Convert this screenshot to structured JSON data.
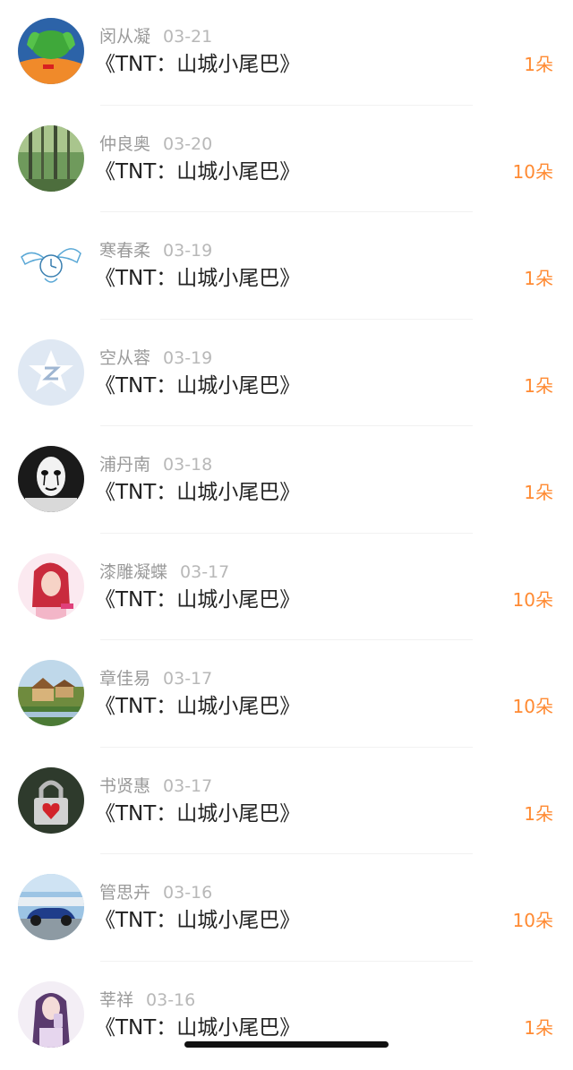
{
  "colors": {
    "accent": "#ff8a32",
    "title": "#222222",
    "name": "#9a9a9a",
    "date": "#b8b8b8"
  },
  "gifts": [
    {
      "name": "闵从凝",
      "date": "03-21",
      "title": "《TNT：山城小尾巴》",
      "count": "1朵",
      "avatar_icon": "frog-hands-avatar"
    },
    {
      "name": "仲良奥",
      "date": "03-20",
      "title": "《TNT：山城小尾巴》",
      "count": "10朵",
      "avatar_icon": "forest-avatar"
    },
    {
      "name": "寒春柔",
      "date": "03-19",
      "title": "《TNT：山城小尾巴》",
      "count": "1朵",
      "avatar_icon": "winged-clock-avatar"
    },
    {
      "name": "空从蓉",
      "date": "03-19",
      "title": "《TNT：山城小尾巴》",
      "count": "1朵",
      "avatar_icon": "default-qzone-avatar"
    },
    {
      "name": "浦丹南",
      "date": "03-18",
      "title": "《TNT：山城小尾巴》",
      "count": "1朵",
      "avatar_icon": "mime-mask-avatar"
    },
    {
      "name": "漆雕凝蝶",
      "date": "03-17",
      "title": "《TNT：山城小尾巴》",
      "count": "10朵",
      "avatar_icon": "red-hair-girl-avatar"
    },
    {
      "name": "章佳易",
      "date": "03-17",
      "title": "《TNT：山城小尾巴》",
      "count": "10朵",
      "avatar_icon": "cottage-landscape-avatar"
    },
    {
      "name": "书贤惠",
      "date": "03-17",
      "title": "《TNT：山城小尾巴》",
      "count": "1朵",
      "avatar_icon": "heart-padlock-avatar"
    },
    {
      "name": "管思卉",
      "date": "03-16",
      "title": "《TNT：山城小尾巴》",
      "count": "10朵",
      "avatar_icon": "blue-car-avatar"
    },
    {
      "name": "莘祥",
      "date": "03-16",
      "title": "《TNT：山城小尾巴》",
      "count": "1朵",
      "avatar_icon": "purple-hair-girl-avatar"
    }
  ]
}
